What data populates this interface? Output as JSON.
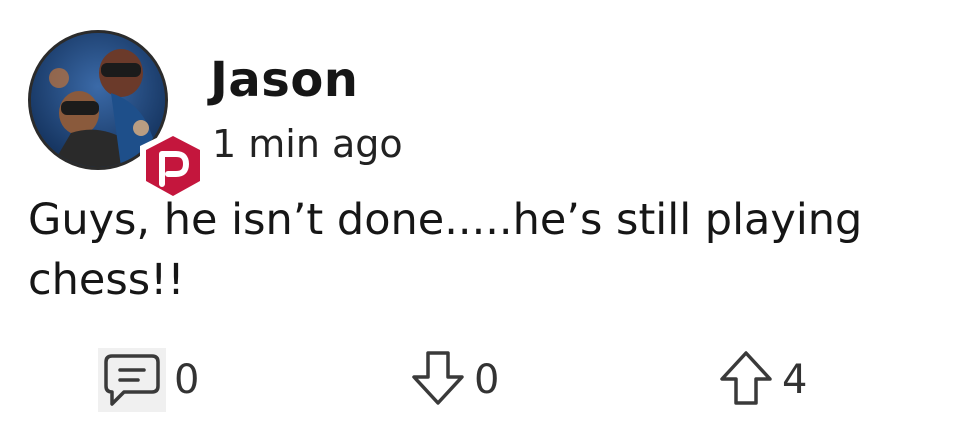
{
  "post": {
    "author": "Jason",
    "timestamp": "1 min ago",
    "text": "Guys, he isn’t done.....he’s still playing chess!!",
    "badge_letter": "P",
    "badge_color": "#c4163d",
    "avatar_icon": "user-avatar-photo"
  },
  "actions": {
    "comment": {
      "icon": "comment-icon",
      "count": "0"
    },
    "downvote": {
      "icon": "arrow-down-icon",
      "count": "0"
    },
    "upvote": {
      "icon": "arrow-up-icon",
      "count": "4"
    }
  }
}
